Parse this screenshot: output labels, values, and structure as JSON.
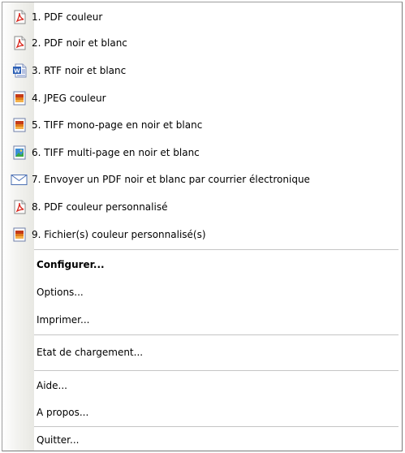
{
  "menu": {
    "items": [
      {
        "label": "1. PDF couleur",
        "icon": "pdf-icon"
      },
      {
        "label": "2. PDF noir et blanc",
        "icon": "pdf-icon"
      },
      {
        "label": "3. RTF noir et blanc",
        "icon": "word-document-icon"
      },
      {
        "label": "4. JPEG couleur",
        "icon": "image-file-icon"
      },
      {
        "label": "5. TIFF mono-page en noir et blanc",
        "icon": "image-file-icon"
      },
      {
        "label": "6. TIFF multi-page en noir et blanc",
        "icon": "multi-image-file-icon"
      },
      {
        "label": "7. Envoyer un PDF noir et blanc par courrier électronique",
        "icon": "envelope-icon"
      },
      {
        "label": "8. PDF couleur personnalisé",
        "icon": "pdf-icon"
      },
      {
        "label": "9. Fichier(s) couleur personnalisé(s)",
        "icon": "image-file-icon"
      }
    ],
    "configure_label": "Configurer...",
    "options_label": "Options...",
    "print_label": "Imprimer...",
    "load_status_label": "Etat de chargement...",
    "help_label": "Aide...",
    "about_label": "A propos...",
    "quit_label": "Quitter..."
  },
  "colors": {
    "pdf_red": "#d9261c",
    "word_blue": "#2b5fb5",
    "image_orange": "#e07b1a",
    "envelope_blue": "#4a6fb3"
  }
}
